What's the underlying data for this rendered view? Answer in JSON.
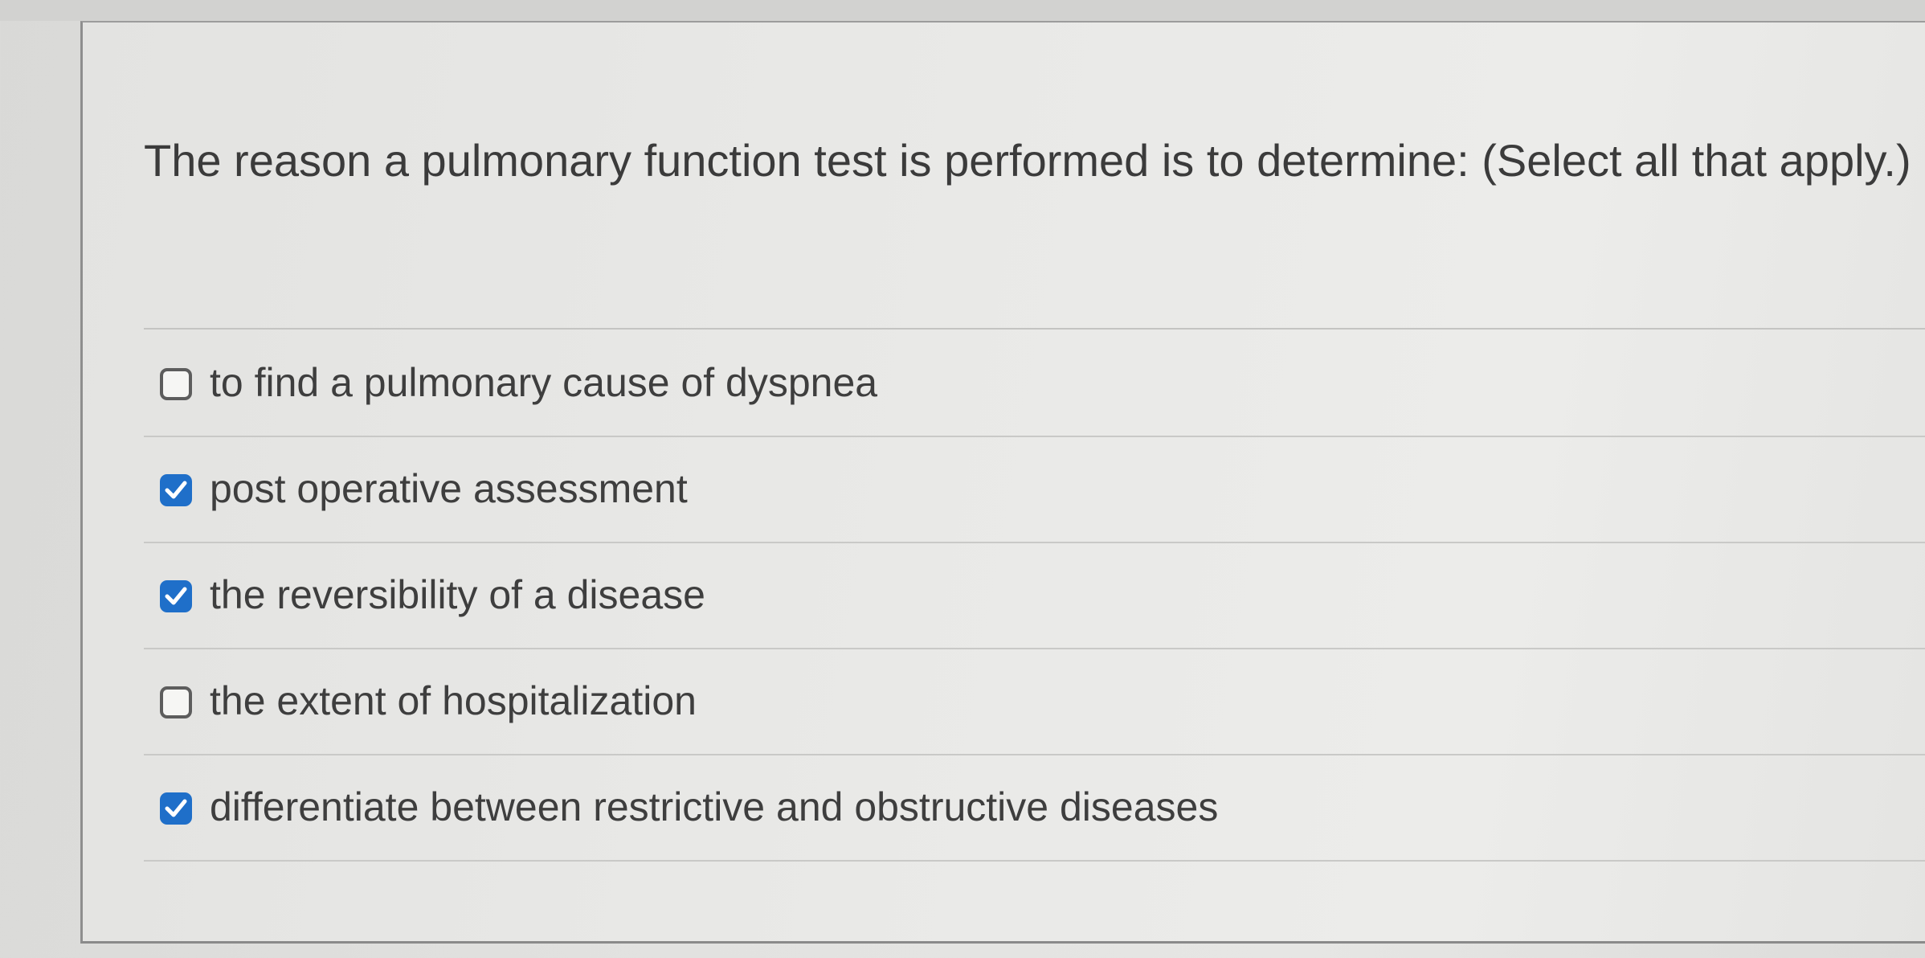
{
  "question": {
    "text": "The reason a pulmonary function test is performed is to determine: (Select all that apply.)"
  },
  "options": [
    {
      "label": "to find a pulmonary cause of dyspnea",
      "checked": false
    },
    {
      "label": "post operative assessment",
      "checked": true
    },
    {
      "label": "the reversibility of a disease",
      "checked": true
    },
    {
      "label": "the extent of hospitalization",
      "checked": false
    },
    {
      "label": "differentiate between restrictive and obstructive diseases",
      "checked": true
    }
  ],
  "colors": {
    "checkbox_checked": "#1f6fc9",
    "text": "#3e3e3e"
  }
}
